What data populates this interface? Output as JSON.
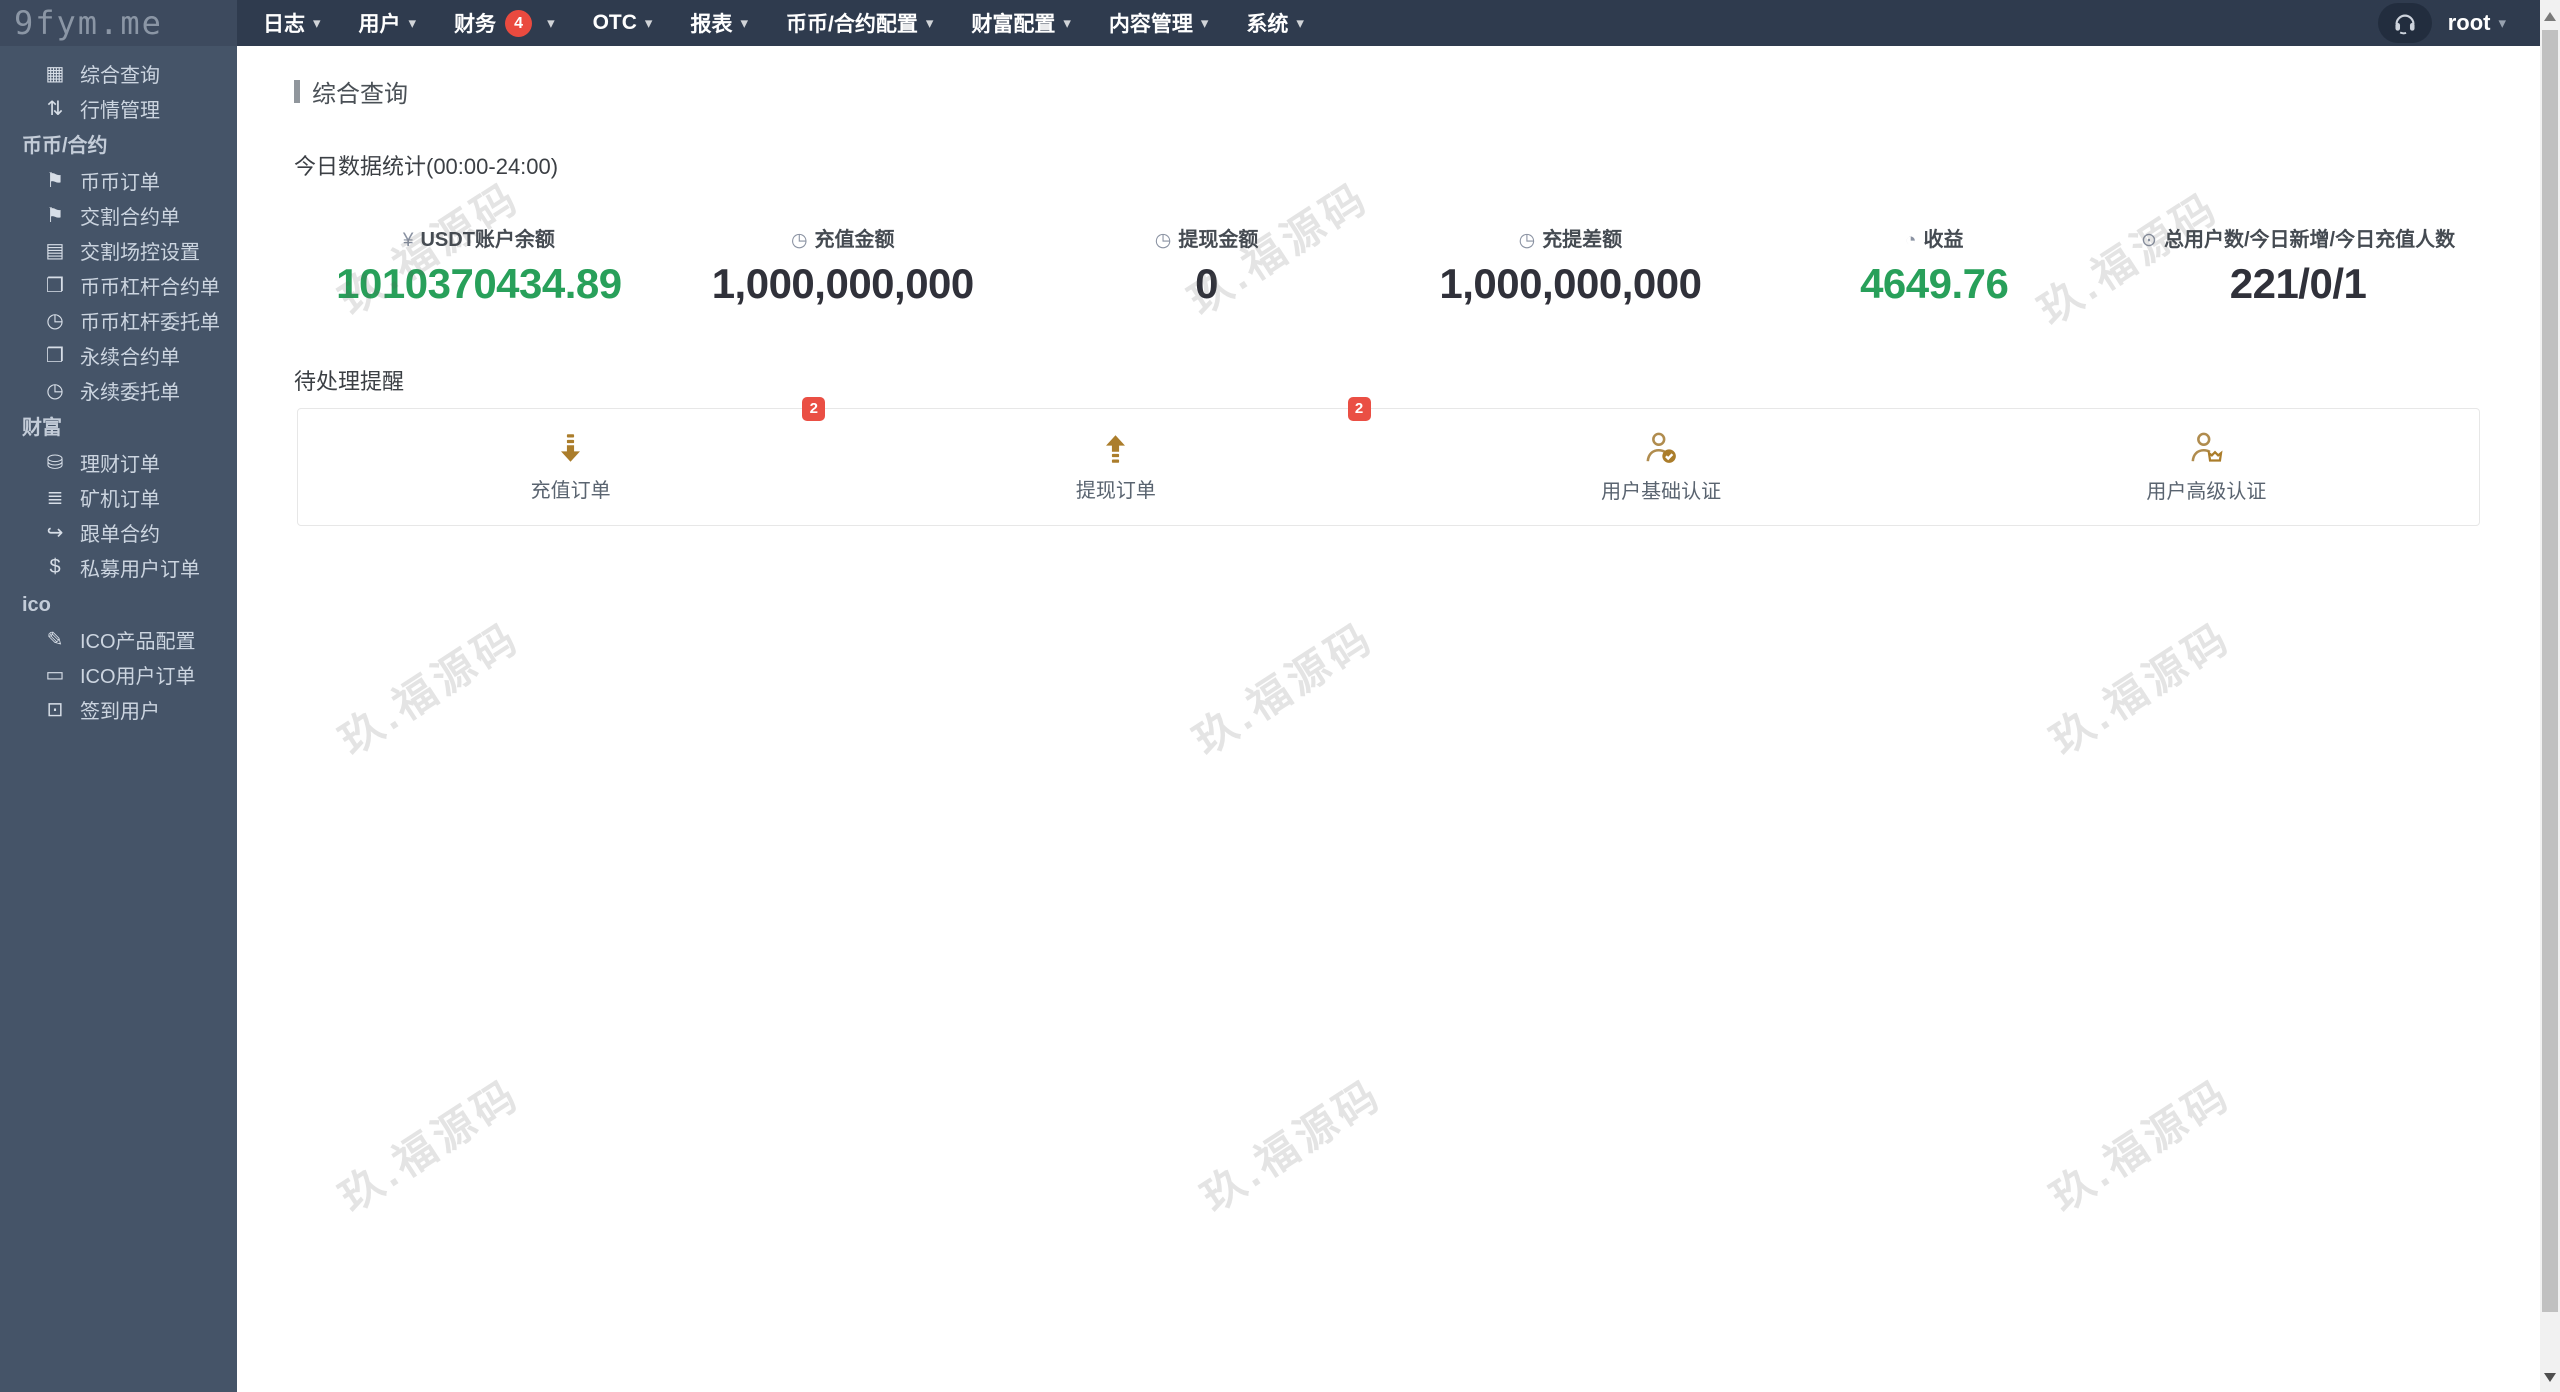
{
  "logo": {
    "text": "9fym.me"
  },
  "topnav": {
    "items": [
      {
        "label": "日志"
      },
      {
        "label": "用户"
      },
      {
        "label": "财务",
        "badge": "4"
      },
      {
        "label": "OTC"
      },
      {
        "label": "报表"
      },
      {
        "label": "币币/合约配置"
      },
      {
        "label": "财富配置"
      },
      {
        "label": "内容管理"
      },
      {
        "label": "系统"
      }
    ],
    "user": {
      "name": "root"
    }
  },
  "sidebar": {
    "items": [
      {
        "label": "综合查询",
        "icon": "grid-icon"
      },
      {
        "label": "行情管理",
        "icon": "sort-icon"
      },
      {
        "label": "币币/合约",
        "type": "header"
      },
      {
        "label": "币币订单",
        "icon": "bookmark-icon"
      },
      {
        "label": "交割合约单",
        "icon": "bookmark-icon"
      },
      {
        "label": "交割场控设置",
        "icon": "clipboard-icon"
      },
      {
        "label": "币币杠杆合约单",
        "icon": "copy-icon"
      },
      {
        "label": "币币杠杆委托单",
        "icon": "file-clock-icon"
      },
      {
        "label": "永续合约单",
        "icon": "copy-icon"
      },
      {
        "label": "永续委托单",
        "icon": "file-clock-icon"
      },
      {
        "label": "财富",
        "type": "header"
      },
      {
        "label": "理财订单",
        "icon": "coins-icon"
      },
      {
        "label": "矿机订单",
        "icon": "layers-icon"
      },
      {
        "label": "跟单合约",
        "icon": "follow-icon"
      },
      {
        "label": "私募用户订单",
        "icon": "dollar-icon"
      },
      {
        "label": "ico",
        "type": "header"
      },
      {
        "label": "ICO产品配置",
        "icon": "file-edit-icon"
      },
      {
        "label": "ICO用户订单",
        "icon": "monitor-icon"
      },
      {
        "label": "签到用户",
        "icon": "signin-icon"
      }
    ]
  },
  "main": {
    "title": "综合查询",
    "subtitle": "今日数据统计(00:00-24:00)",
    "stats": [
      {
        "icon": "yuan-icon",
        "label": "USDT账户余额",
        "value": "1010370434.89",
        "emphasis": "green"
      },
      {
        "icon": "file-clock-icon",
        "label": "充值金额",
        "value": "1,000,000,000",
        "emphasis": "dark"
      },
      {
        "icon": "file-clock-icon",
        "label": "提现金额",
        "value": "0",
        "emphasis": "dark"
      },
      {
        "icon": "file-clock-icon",
        "label": "充提差额",
        "value": "1,000,000,000",
        "emphasis": "dark"
      },
      {
        "icon": "clock-icon",
        "label": "收益",
        "value": "4649.76",
        "emphasis": "green"
      },
      {
        "icon": "users-icon",
        "label": "总用户数/今日新增/今日充值人数",
        "value": "221/0/1",
        "emphasis": "dark"
      }
    ],
    "pending": {
      "title": "待处理提醒",
      "items": [
        {
          "icon": "deposit-arrow-icon",
          "label": "充值订单",
          "badge": "2"
        },
        {
          "icon": "withdraw-arrow-icon",
          "label": "提现订单",
          "badge": "2"
        },
        {
          "icon": "user-basic-verify-icon",
          "label": "用户基础认证"
        },
        {
          "icon": "user-advanced-verify-icon",
          "label": "用户高级认证"
        }
      ]
    }
  },
  "watermark": {
    "text": "玖.福源码"
  },
  "glyphs": {
    "grid": "▦",
    "sort": "⇅",
    "bookmark": "⚑",
    "clipboard": "▤",
    "copy": "❐",
    "fileclock": "◷",
    "coins": "⛁",
    "layers": "≣",
    "follow": "↪",
    "dollar": "$",
    "fileedit": "✎",
    "monitor": "▭",
    "signin": "⊡",
    "yuan": "¥",
    "clock": "◔",
    "users": "⊙",
    "caret": "▾"
  },
  "colors": {
    "topbar": "#2f3b4e",
    "sidebar": "#455468",
    "accent_green": "#28a05a",
    "badge_red": "#ea4a3f",
    "gold": "#ab7d2b"
  }
}
